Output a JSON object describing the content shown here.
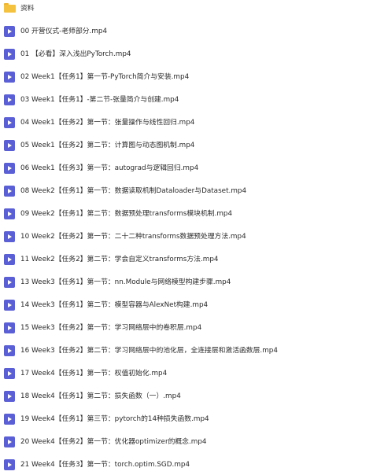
{
  "folder": {
    "label": "资料",
    "icon": "folder-icon",
    "color": "#f5c240"
  },
  "video_icon": {
    "icon": "video-play-icon",
    "color": "#5b5fd6"
  },
  "files": [
    {
      "label": "00 开营仪式-老师部分.mp4"
    },
    {
      "label": "01 【必看】深入浅出PyTorch.mp4"
    },
    {
      "label": "02 Week1【任务1】第一节-PyTorch简介与安装.mp4"
    },
    {
      "label": "03 Week1【任务1】-第二节-张量简介与创建.mp4"
    },
    {
      "label": "04 Week1【任务2】第一节：张量操作与线性回归.mp4"
    },
    {
      "label": "05 Week1【任务2】第二节：计算图与动态图机制.mp4"
    },
    {
      "label": "06 Week1【任务3】第一节：autograd与逻辑回归.mp4"
    },
    {
      "label": "08 Week2【任务1】第一节：数据读取机制Dataloader与Dataset.mp4"
    },
    {
      "label": "09 Week2【任务1】第二节：数据预处理transforms模块机制.mp4"
    },
    {
      "label": "10 Week2【任务2】第一节：二十二种transforms数据预处理方法.mp4"
    },
    {
      "label": "11 Week2【任务2】第二节：学会自定义transforms方法.mp4"
    },
    {
      "label": "13 Week3【任务1】第一节：nn.Module与网络模型构建步骤.mp4"
    },
    {
      "label": "14 Week3【任务1】第二节：模型容器与AlexNet构建.mp4"
    },
    {
      "label": "15 Week3【任务2】第一节：学习网络层中的卷积层.mp4"
    },
    {
      "label": "16 Week3【任务2】第二节：学习网络层中的池化层，全连接层和激活函数层.mp4"
    },
    {
      "label": "17 Week4【任务1】第一节：权值初始化.mp4"
    },
    {
      "label": "18 Week4【任务1】第二节：损失函数（一）.mp4"
    },
    {
      "label": "19 Week4【任务1】第三节：pytorch的14种损失函数.mp4"
    },
    {
      "label": "20 Week4【任务2】第一节：优化器optimizer的概念.mp4"
    },
    {
      "label": "21 Week4【任务3】第一节：torch.optim.SGD.mp4"
    }
  ]
}
